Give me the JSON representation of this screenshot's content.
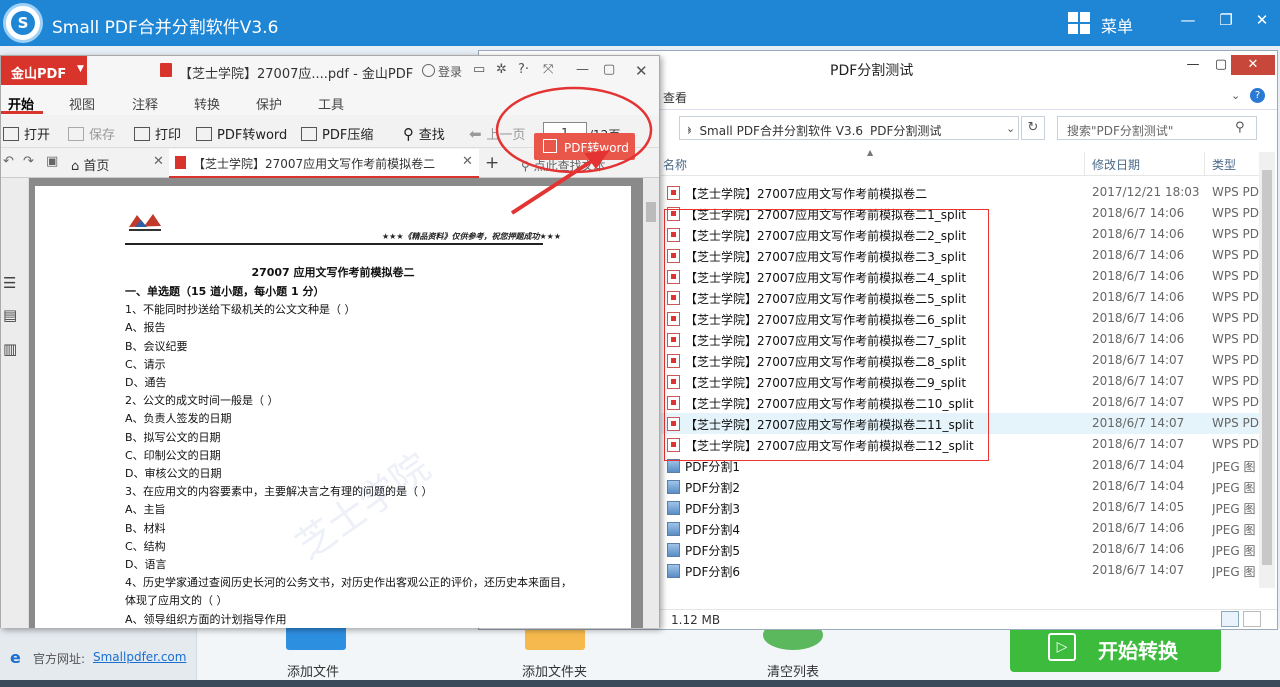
{
  "app": {
    "title": "Small PDF合并分割软件V3.6",
    "logo_letter": "S",
    "menu_label": "菜单",
    "window_controls": [
      "—",
      "❐",
      "✕"
    ],
    "site_label": "官方网址:",
    "site_link": "Smallpdfer.com",
    "tools": [
      "添加文件",
      "添加文件夹",
      "清空列表"
    ],
    "start_label": "开始转换"
  },
  "explorer": {
    "title": "PDF分割测试",
    "ribbon_tab": "查看",
    "path": [
      "Small PDF合并分割软件 V3.6",
      "PDF分割测试"
    ],
    "search_placeholder": "搜索\"PDF分割测试\"",
    "columns": [
      "名称",
      "修改日期",
      "类型"
    ],
    "status_size": "1.12 MB",
    "files": [
      {
        "name": "【芝士学院】27007应用文写作考前模拟卷二",
        "date": "2017/12/21 18:03",
        "type": "WPS PDF",
        "icon": "pdf",
        "selected": false
      },
      {
        "name": "【芝士学院】27007应用文写作考前模拟卷二1_split",
        "date": "2018/6/7 14:06",
        "type": "WPS PDF",
        "icon": "pdf",
        "selected": false
      },
      {
        "name": "【芝士学院】27007应用文写作考前模拟卷二2_split",
        "date": "2018/6/7 14:06",
        "type": "WPS PDF",
        "icon": "pdf",
        "selected": false
      },
      {
        "name": "【芝士学院】27007应用文写作考前模拟卷二3_split",
        "date": "2018/6/7 14:06",
        "type": "WPS PDF",
        "icon": "pdf",
        "selected": false
      },
      {
        "name": "【芝士学院】27007应用文写作考前模拟卷二4_split",
        "date": "2018/6/7 14:06",
        "type": "WPS PDF",
        "icon": "pdf",
        "selected": false
      },
      {
        "name": "【芝士学院】27007应用文写作考前模拟卷二5_split",
        "date": "2018/6/7 14:06",
        "type": "WPS PDF",
        "icon": "pdf",
        "selected": false
      },
      {
        "name": "【芝士学院】27007应用文写作考前模拟卷二6_split",
        "date": "2018/6/7 14:06",
        "type": "WPS PDF",
        "icon": "pdf",
        "selected": false
      },
      {
        "name": "【芝士学院】27007应用文写作考前模拟卷二7_split",
        "date": "2018/6/7 14:06",
        "type": "WPS PDF",
        "icon": "pdf",
        "selected": false
      },
      {
        "name": "【芝士学院】27007应用文写作考前模拟卷二8_split",
        "date": "2018/6/7 14:07",
        "type": "WPS PDF",
        "icon": "pdf",
        "selected": false
      },
      {
        "name": "【芝士学院】27007应用文写作考前模拟卷二9_split",
        "date": "2018/6/7 14:07",
        "type": "WPS PDF",
        "icon": "pdf",
        "selected": false
      },
      {
        "name": "【芝士学院】27007应用文写作考前模拟卷二10_split",
        "date": "2018/6/7 14:07",
        "type": "WPS PDF",
        "icon": "pdf",
        "selected": false
      },
      {
        "name": "【芝士学院】27007应用文写作考前模拟卷二11_split",
        "date": "2018/6/7 14:07",
        "type": "WPS PDF",
        "icon": "pdf",
        "selected": true
      },
      {
        "name": "【芝士学院】27007应用文写作考前模拟卷二12_split",
        "date": "2018/6/7 14:07",
        "type": "WPS PDF",
        "icon": "pdf",
        "selected": false
      },
      {
        "name": "PDF分割1",
        "date": "2018/6/7 14:04",
        "type": "JPEG 图",
        "icon": "jpg",
        "selected": false
      },
      {
        "name": "PDF分割2",
        "date": "2018/6/7 14:04",
        "type": "JPEG 图",
        "icon": "jpg",
        "selected": false
      },
      {
        "name": "PDF分割3",
        "date": "2018/6/7 14:05",
        "type": "JPEG 图",
        "icon": "jpg",
        "selected": false
      },
      {
        "name": "PDF分割4",
        "date": "2018/6/7 14:06",
        "type": "JPEG 图",
        "icon": "jpg",
        "selected": false
      },
      {
        "name": "PDF分割5",
        "date": "2018/6/7 14:06",
        "type": "JPEG 图",
        "icon": "jpg",
        "selected": false
      },
      {
        "name": "PDF分割6",
        "date": "2018/6/7 14:07",
        "type": "JPEG 图",
        "icon": "jpg",
        "selected": false
      }
    ]
  },
  "wps": {
    "logo": "金山PDF",
    "doc_title": "【芝士学院】27007应....pdf - 金山PDF",
    "login": "登录",
    "tabs": [
      "开始",
      "视图",
      "注释",
      "转换",
      "保护",
      "工具"
    ],
    "tools": [
      "打开",
      "保存",
      "打印",
      "PDF转word",
      "PDF压缩",
      "查找",
      "上一页"
    ],
    "page_current": "1",
    "page_total": "/12页",
    "home_tab": "首页",
    "doc_tab": "【芝士学院】27007应用文写作考前模拟卷二",
    "search_hint": "点此查找文本",
    "to_word": "PDF转word"
  },
  "document": {
    "slogan": "★★★《精品资料》仅供参考，祝您押题成功★★★",
    "title": "27007 应用文写作考前模拟卷二",
    "watermark": "芝士学院",
    "lines": [
      {
        "text": "一、单选题（15 道小题，每小题 1 分）",
        "bold": true
      },
      {
        "text": "1、不能同时抄送给下级机关的公文文种是（   ）",
        "bold": false
      },
      {
        "text": "A、报告",
        "bold": false
      },
      {
        "text": "B、会议纪要",
        "bold": false
      },
      {
        "text": "C、请示",
        "bold": false
      },
      {
        "text": "D、通告",
        "bold": false
      },
      {
        "text": "2、公文的成文时间一般是（   ）",
        "bold": false
      },
      {
        "text": "A、负责人签发的日期",
        "bold": false
      },
      {
        "text": "B、拟写公文的日期",
        "bold": false
      },
      {
        "text": "C、印制公文的日期",
        "bold": false
      },
      {
        "text": "D、审核公文的日期",
        "bold": false
      },
      {
        "text": "3、在应用文的内容要素中，主要解决言之有理的问题的是（   ）",
        "bold": false
      },
      {
        "text": "A、主旨",
        "bold": false
      },
      {
        "text": "B、材料",
        "bold": false
      },
      {
        "text": "C、结构",
        "bold": false
      },
      {
        "text": "D、语言",
        "bold": false
      },
      {
        "text": "4、历史学家通过查阅历史长河的公务文书，对历史作出客观公正的评价，还历史本来面目，",
        "bold": false
      },
      {
        "text": "体现了应用文的（   ）",
        "bold": false
      },
      {
        "text": "A、领导组织方面的计划指导作用",
        "bold": false
      }
    ]
  },
  "colors": {
    "app_blue": "#1f86d6",
    "wps_red": "#d8342b",
    "start_green": "#3dbb3d",
    "annotation_red": "#e33333"
  }
}
